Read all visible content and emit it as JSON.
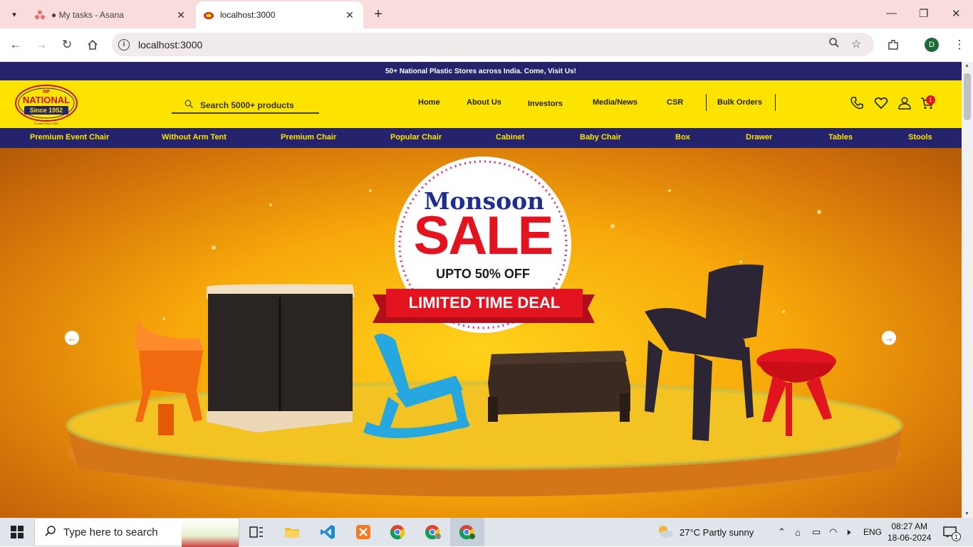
{
  "browser": {
    "tabs": [
      {
        "title": "● My tasks - Asana",
        "active": false
      },
      {
        "title": "localhost:3000",
        "active": true
      }
    ],
    "url": "localhost:3000",
    "profile_initial": "D"
  },
  "site": {
    "announcement": "50+ National Plastic Stores across India. Come, Visit Us!",
    "logo": {
      "brand": "NATIONAL",
      "since": "Since 1952",
      "np": "NP",
      "tagline": "Trusted Since 1952"
    },
    "search_placeholder": "Search 5000+ products",
    "nav": [
      "Home",
      "About Us",
      "Investors",
      "Media/News",
      "CSR",
      "Bulk Orders"
    ],
    "cart_count": "1",
    "categories": [
      "Premium Event Chair",
      "Without Arm Tent",
      "Premium Chair",
      "Popular Chair",
      "Cabinet",
      "Baby Chair",
      "Box",
      "Drawer",
      "Tables",
      "Stools"
    ],
    "banner": {
      "line1": "Monsoon",
      "line2": "SALE",
      "line3": "UPTO 50% OFF",
      "ribbon": "LIMITED TIME DEAL"
    }
  },
  "taskbar": {
    "search_placeholder": "Type here to search",
    "weather": "27°C  Partly sunny",
    "lang": "ENG",
    "time": "08:27 AM",
    "date": "18-06-2024",
    "notifications": "1"
  }
}
